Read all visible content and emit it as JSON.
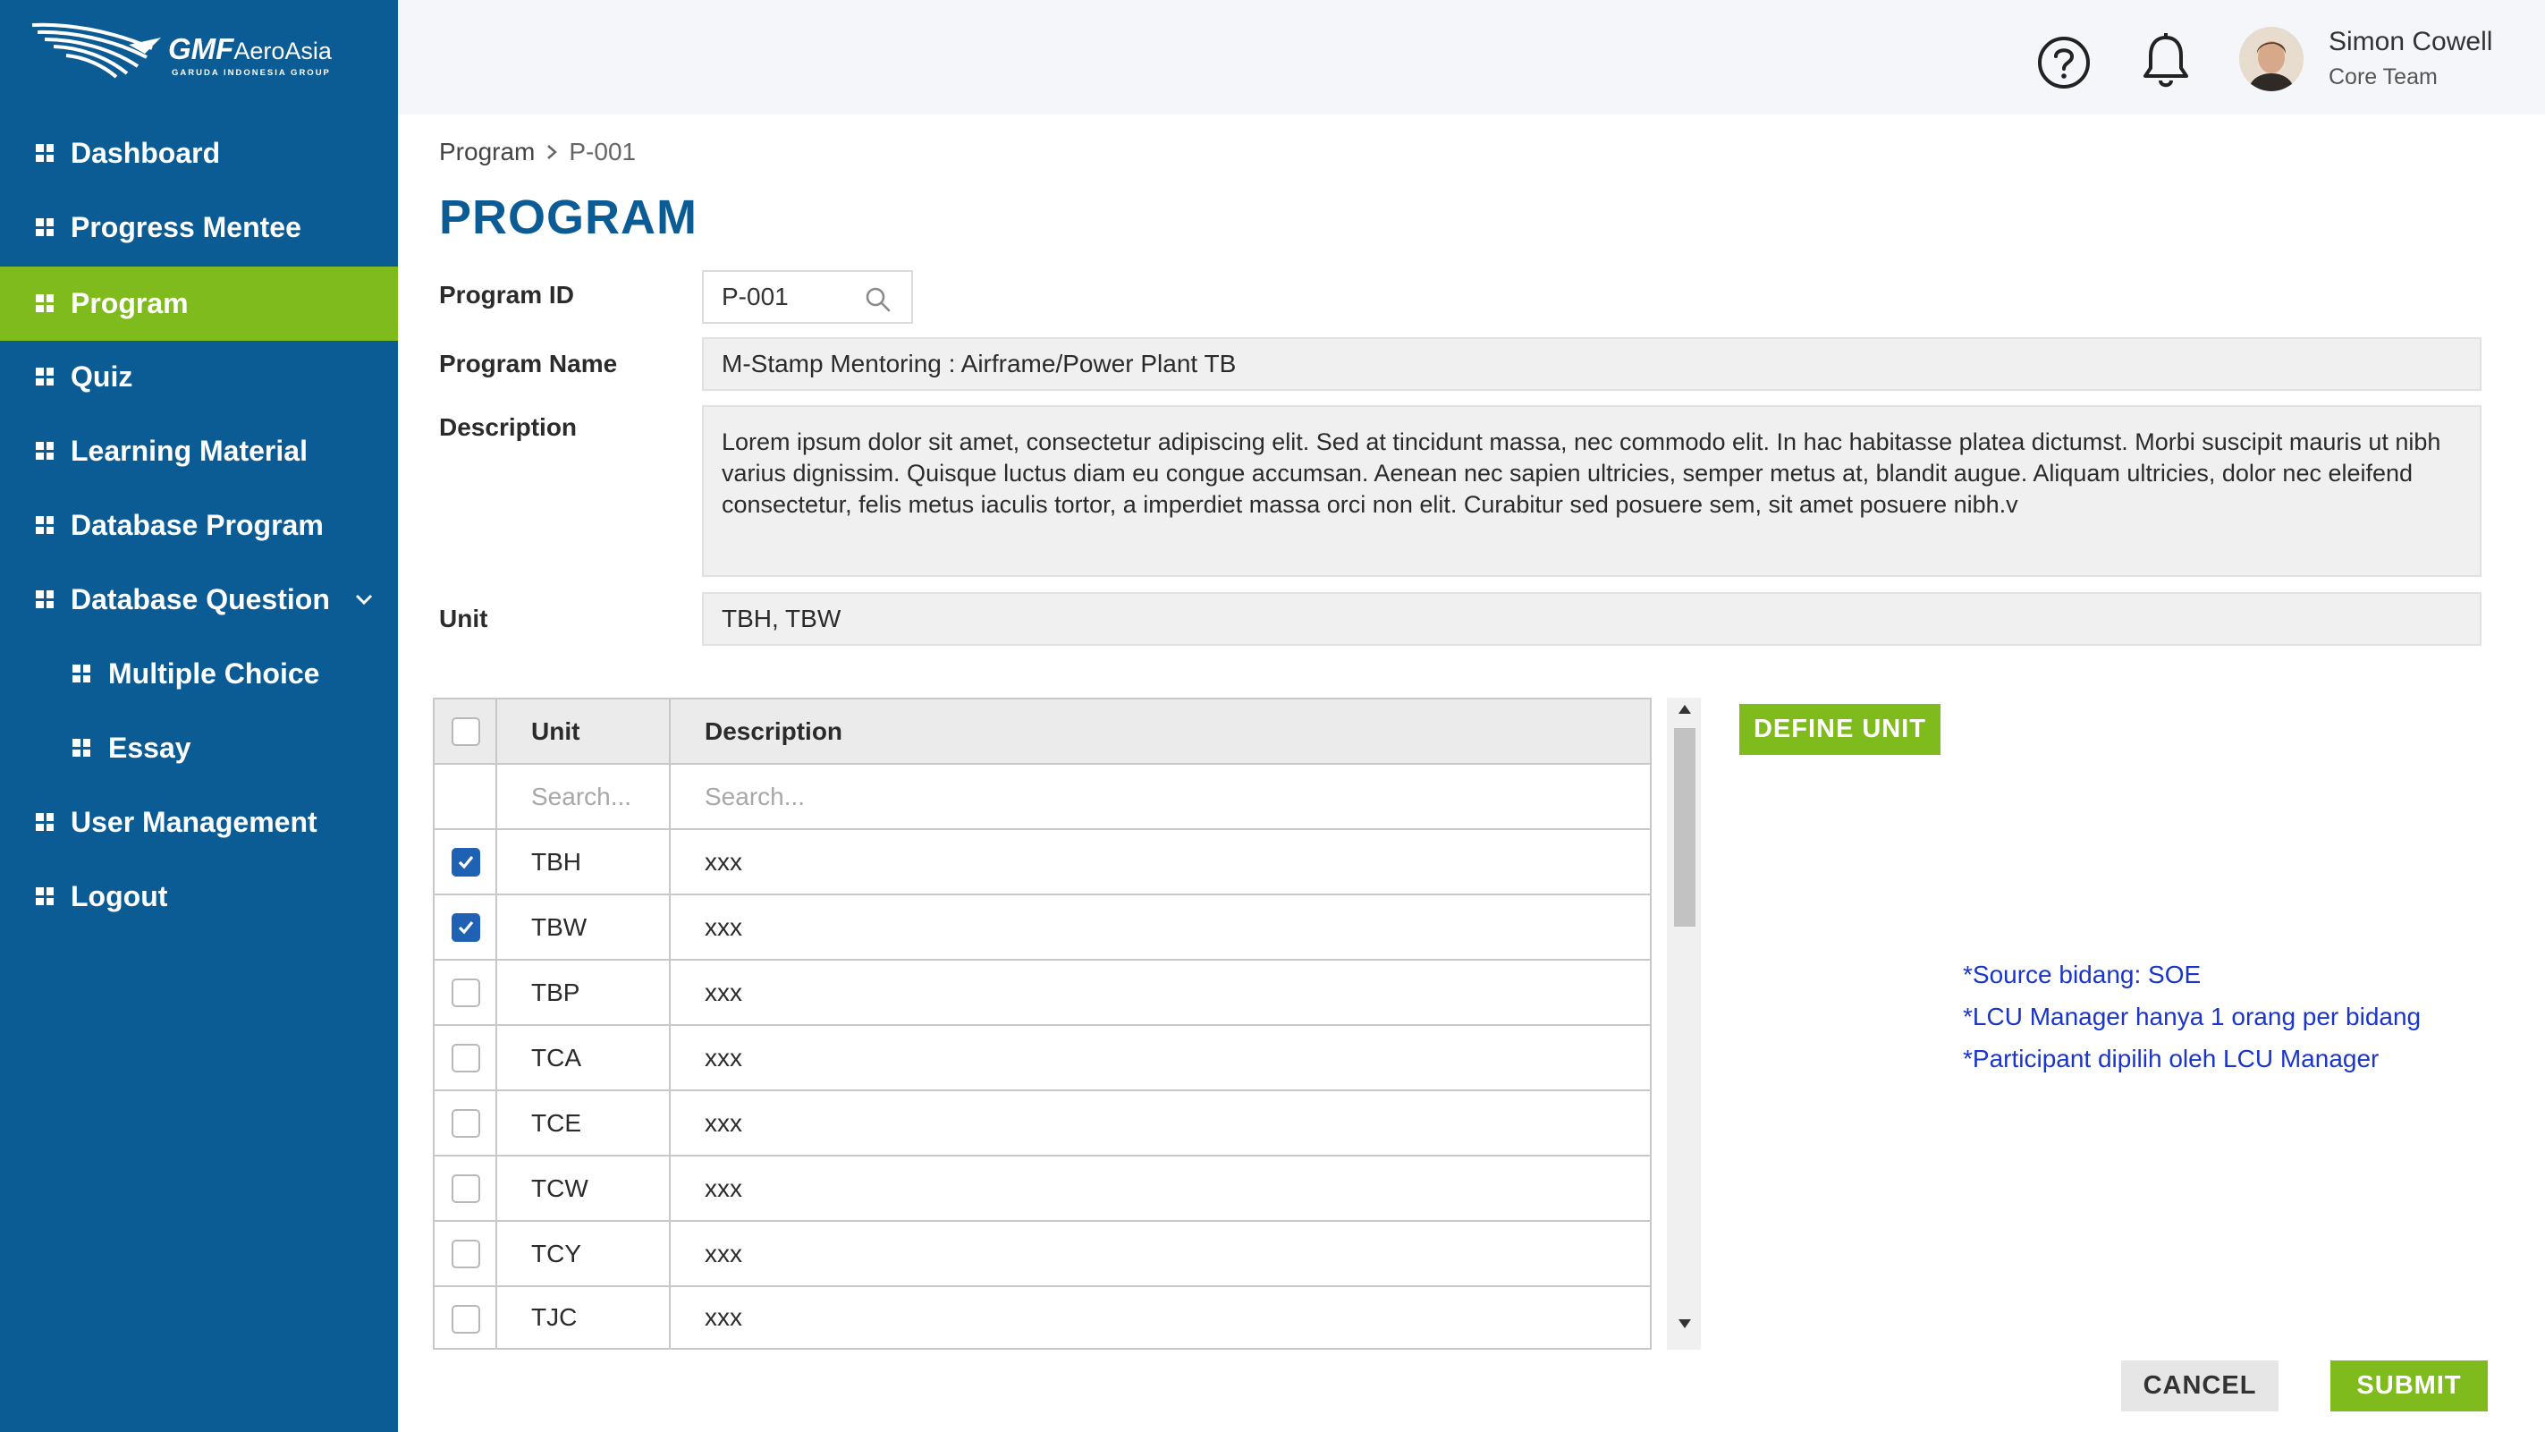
{
  "brand": {
    "name_bold": "GMF",
    "name_light": "AeroAsia",
    "tagline": "GARUDA INDONESIA GROUP"
  },
  "sidebar": {
    "items": [
      {
        "label": "Dashboard",
        "active": false
      },
      {
        "label": "Progress Mentee",
        "active": false
      },
      {
        "label": "Program",
        "active": true
      },
      {
        "label": "Quiz",
        "active": false
      },
      {
        "label": "Learning Material",
        "active": false
      },
      {
        "label": "Database Program",
        "active": false
      },
      {
        "label": "Database Question",
        "active": false,
        "expanded": true
      },
      {
        "label": "Multiple Choice",
        "active": false,
        "sub": true
      },
      {
        "label": "Essay",
        "active": false,
        "sub": true
      },
      {
        "label": "User Management",
        "active": false
      },
      {
        "label": "Logout",
        "active": false
      }
    ]
  },
  "header": {
    "icons": [
      "help-icon",
      "bell-icon"
    ],
    "user": {
      "name": "Simon Cowell",
      "role": "Core Team"
    }
  },
  "breadcrumb": {
    "root": "Program",
    "separator": ">",
    "current": "P-001"
  },
  "page": {
    "title": "PROGRAM"
  },
  "form": {
    "program_id": {
      "label": "Program ID",
      "value": "P-001"
    },
    "program_name": {
      "label": "Program Name",
      "value": "M-Stamp Mentoring : Airframe/Power Plant TB"
    },
    "description": {
      "label": "Description",
      "value": "Lorem ipsum dolor sit amet, consectetur adipiscing elit. Sed at tincidunt massa, nec commodo elit. In hac habitasse platea dictumst. Morbi suscipit mauris ut nibh varius dignissim. Quisque luctus diam eu congue accumsan. Aenean nec sapien ultricies, semper metus at, blandit augue. Aliquam ultricies, dolor nec eleifend consectetur, felis metus iaculis tortor, a imperdiet massa orci non elit. Curabitur sed posuere sem, sit amet posuere nibh.v"
    },
    "unit": {
      "label": "Unit",
      "value": "TBH, TBW"
    }
  },
  "unit_table": {
    "columns": [
      "Unit",
      "Description"
    ],
    "search_placeholders": [
      "Search...",
      "Search..."
    ],
    "rows": [
      {
        "unit": "TBH",
        "description": "xxx",
        "checked": true
      },
      {
        "unit": "TBW",
        "description": "xxx",
        "checked": true
      },
      {
        "unit": "TBP",
        "description": "xxx",
        "checked": false
      },
      {
        "unit": "TCA",
        "description": "xxx",
        "checked": false
      },
      {
        "unit": "TCE",
        "description": "xxx",
        "checked": false
      },
      {
        "unit": "TCW",
        "description": "xxx",
        "checked": false
      },
      {
        "unit": "TCY",
        "description": "xxx",
        "checked": false
      },
      {
        "unit": "TJC",
        "description": "xxx",
        "checked": false
      }
    ]
  },
  "buttons": {
    "define_unit": "DEFINE UNIT",
    "cancel": "CANCEL",
    "submit": "SUBMIT"
  },
  "notes": [
    "*Source bidang: SOE",
    "*LCU Manager hanya 1 orang per bidang",
    "*Participant dipilih oleh LCU Manager"
  ],
  "colors": {
    "sidebar": "#0b5c94",
    "accent_green": "#7fbb1d",
    "title_blue": "#0b5c94",
    "note_blue": "#1a35c9",
    "checkbox_blue": "#1f62b3"
  }
}
